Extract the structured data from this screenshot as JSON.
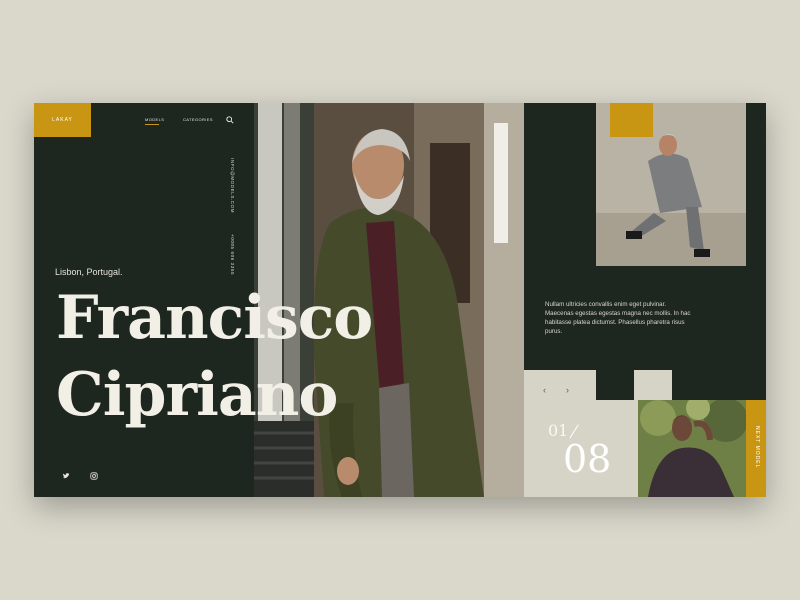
{
  "brand": {
    "logo": "LAKAY"
  },
  "nav": {
    "models": "MODELS",
    "categories": "CATEGORIES",
    "search_icon": "search-icon"
  },
  "contact": {
    "email": "INFO@MODELS.COM",
    "phone": "+0085 606 3355"
  },
  "profile": {
    "location": "Lisbon, Portugal.",
    "first_name": "Francisco",
    "last_name": "Cipriano"
  },
  "description": "Nullam ultricies convallis enim eget pulvinar. Maecenas egestas egestas magna nec mollis. In hac habitasse platea dictumst. Phasellus pharetra risus purus.",
  "pager": {
    "current": "01",
    "total": "08",
    "prev_icon": "chevron-left-icon",
    "next_icon": "chevron-right-icon"
  },
  "next_model": "NEXT MODEL",
  "social": [
    "twitter-icon",
    "instagram-icon"
  ],
  "colors": {
    "background": "#dad8cb",
    "panel": "#1e2620",
    "accent": "#c99613",
    "light": "#d6d4c7"
  }
}
